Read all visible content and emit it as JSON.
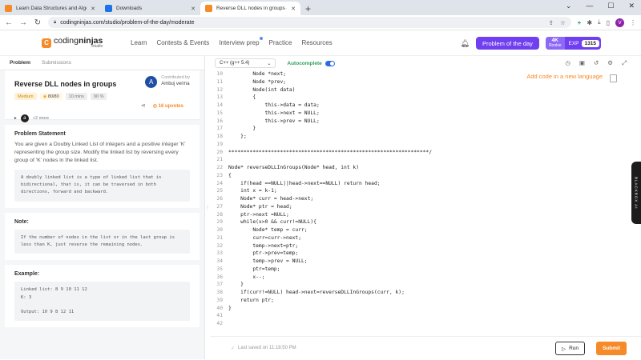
{
  "browser": {
    "tabs": [
      {
        "title": "Learn Data Structures and Algori",
        "icon": "codingninjas-favicon"
      },
      {
        "title": "Downloads",
        "icon": "download-favicon"
      },
      {
        "title": "Reverse DLL nodes in groups - C",
        "icon": "codingninjas-favicon",
        "active": true
      }
    ],
    "url": "codingninjas.com/studio/problem-of-the-day/moderate",
    "new_tab": "+"
  },
  "site": {
    "logo_main_a": "coding",
    "logo_main_b": "ninjas",
    "logo_sub": "/studio",
    "menu": [
      "Learn",
      "Contests & Events",
      "Interview prep",
      "Practice",
      "Resources"
    ],
    "potd_button": "Problem of the day",
    "rank_top": "4K",
    "rank_bottom": "Rookie",
    "xp_label": "EXP",
    "xp_value": "1315"
  },
  "problem_panel": {
    "tabs": [
      "Problem",
      "Submissions"
    ],
    "title": "Reverse DLL nodes in groups",
    "difficulty": "Medium",
    "score": "80/80",
    "time": "10 mins",
    "success": "90 %",
    "contributed_label": "Contributed by",
    "contributor": "Ambuj verma",
    "contributor_initial": "A",
    "upvotes": "16 upvotes",
    "company_initial": "a",
    "more_companies": "+2 more",
    "statement_heading": "Problem Statement",
    "statement": "You are given a Doubly Linked List of integers and a positive integer 'K' representing the group size. Modify the linked list by reversing every group of 'K' nodes in the linked list.",
    "info_box": "A doubly linked list is a type of linked list that is bidirectional, that is, it can be traversed in both directions, forward and backward.",
    "note_heading": "Note:",
    "note_box": "If the number of nodes in the list or in the last group is less than K, just reverse the remaining nodes.",
    "example_heading": "Example:",
    "example_lines": [
      "Linked list: 8 9 10 11 12",
      "K: 3",
      "",
      "Output: 10 9 8 12 11"
    ]
  },
  "editor": {
    "language": "C++ (g++ 5.4)",
    "autocomplete": "Autocomplete",
    "hint": "Add code in a new language",
    "side_tab": "BLACKBOX AI",
    "saved": "Last saved on 11:18:50 PM",
    "run": "Run",
    "submit": "Submit",
    "lines": [
      {
        "n": "10",
        "t": "        Node *next;"
      },
      {
        "n": "11",
        "t": "        Node *prev;"
      },
      {
        "n": "12",
        "t": "        Node(int data)"
      },
      {
        "n": "13",
        "t": "        {"
      },
      {
        "n": "14",
        "t": "            this->data = data;"
      },
      {
        "n": "15",
        "t": "            this->next = NULL;"
      },
      {
        "n": "16",
        "t": "            this->prev = NULL;"
      },
      {
        "n": "17",
        "t": "        }"
      },
      {
        "n": "18",
        "t": "    };"
      },
      {
        "n": "19",
        "t": ""
      },
      {
        "n": "20",
        "t": "******************************************************************/"
      },
      {
        "n": "21",
        "t": ""
      },
      {
        "n": "22",
        "t": "Node* reverseDLLInGroups(Node* head, int k)"
      },
      {
        "n": "23",
        "t": "{"
      },
      {
        "n": "24",
        "t": "    if(head ==NULL||head->next==NULL) return head;"
      },
      {
        "n": "25",
        "t": "    int x = k-1;"
      },
      {
        "n": "26",
        "t": "    Node* curr = head->next;"
      },
      {
        "n": "27",
        "t": "    Node* ptr = head;"
      },
      {
        "n": "28",
        "t": "    ptr->next =NULL;"
      },
      {
        "n": "29",
        "t": "    while(x>0 && curr!=NULL){"
      },
      {
        "n": "30",
        "t": "        Node* temp = curr;"
      },
      {
        "n": "31",
        "t": "        curr=curr->next;"
      },
      {
        "n": "32",
        "t": "        temp->next=ptr;"
      },
      {
        "n": "33",
        "t": "        ptr->prev=temp;"
      },
      {
        "n": "34",
        "t": "        temp->prev = NULL;"
      },
      {
        "n": "35",
        "t": "        ptr=temp;"
      },
      {
        "n": "36",
        "t": "        x--;"
      },
      {
        "n": "37",
        "t": "    }"
      },
      {
        "n": "38",
        "t": "    if(curr!=NULL) head->next=reverseDLLInGroups(curr, k);"
      },
      {
        "n": "39",
        "t": "    return ptr;"
      },
      {
        "n": "40",
        "t": "}"
      },
      {
        "n": "41",
        "t": ""
      },
      {
        "n": "42",
        "t": ""
      }
    ]
  },
  "colors": {
    "brand_orange": "#f78a28",
    "primary_purple": "#6f3ff0",
    "autocomplete_green": "#2e9e5c",
    "toggle_blue": "#2d6cdf"
  }
}
